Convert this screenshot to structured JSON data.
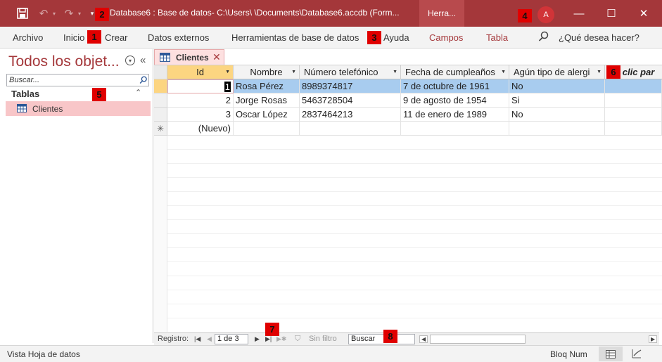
{
  "titlebar": {
    "title": "Database6 : Base de datos- C:\\Users\\        \\Documents\\Database6.accdb (Form...",
    "context_tab": "Herra...",
    "avatar_initial": "A",
    "undo_icon": "undo-icon",
    "redo_icon": "redo-icon",
    "save_icon": "save-icon"
  },
  "ribbon": {
    "tabs": [
      "Archivo",
      "Inicio",
      "Crear",
      "Datos externos",
      "Herramientas de base de datos",
      "Ayuda",
      "Campos",
      "Tabla"
    ],
    "search_prompt": "¿Qué desea hacer?"
  },
  "markers": [
    "1",
    "2",
    "3",
    "4",
    "5",
    "6",
    "7",
    "8"
  ],
  "nav": {
    "title": "Todos los objet...",
    "search_placeholder": "Buscar...",
    "group": "Tablas",
    "items": [
      "Clientes"
    ]
  },
  "document": {
    "tab_label": "Clientes",
    "columns": [
      "Id",
      "Nombre",
      "Número telefónico",
      "Fecha de cumpleaños",
      "Agún tipo de alergi",
      "ga clic par"
    ],
    "rows": [
      {
        "id": "1",
        "nombre": "Rosa Pérez",
        "telefono": "8989374817",
        "fecha": "7 de octubre de 1961",
        "alergia": "No"
      },
      {
        "id": "2",
        "nombre": "Jorge Rosas",
        "telefono": "5463728504",
        "fecha": "9 de agosto de 1954",
        "alergia": "Si"
      },
      {
        "id": "3",
        "nombre": "Oscar López",
        "telefono": "2837464213",
        "fecha": "11 de enero de 1989",
        "alergia": "No"
      }
    ],
    "new_row_label": "(Nuevo)",
    "new_row_marker": "✳"
  },
  "recordbar": {
    "label": "Registro:",
    "position": "1 de 3",
    "filter": "Sin filtro",
    "search": "Buscar"
  },
  "statusbar": {
    "view": "Vista Hoja de datos",
    "numlock": "Bloq Num"
  },
  "colors": {
    "accent": "#a4373a",
    "marker": "#e00000",
    "selection": "#a8ccef"
  }
}
